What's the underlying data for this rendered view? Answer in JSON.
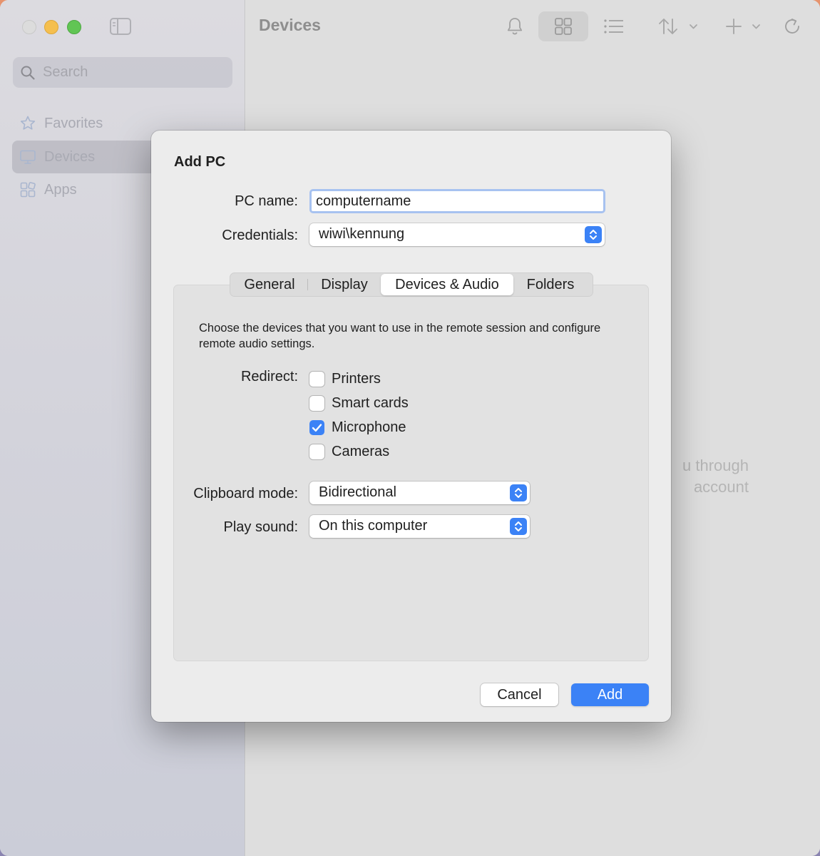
{
  "sidebar": {
    "search_placeholder": "Search",
    "items": [
      {
        "label": "Favorites",
        "icon": "star-icon",
        "selected": false
      },
      {
        "label": "Devices",
        "icon": "monitor-icon",
        "selected": true
      },
      {
        "label": "Apps",
        "icon": "apps-icon",
        "selected": false
      }
    ]
  },
  "toolbar": {
    "title": "Devices",
    "icons": [
      "bell-icon",
      "grid-view-icon",
      "list-view-icon",
      "sort-icon",
      "add-icon",
      "refresh-icon"
    ]
  },
  "main": {
    "empty_line1": "u through",
    "empty_line2": "account"
  },
  "dialog": {
    "title": "Add PC",
    "pc_name_label": "PC name:",
    "pc_name_value": "computername",
    "credentials_label": "Credentials:",
    "credentials_value": "wiwi\\kennung",
    "tabs": [
      {
        "label": "General",
        "selected": false
      },
      {
        "label": "Display",
        "selected": false
      },
      {
        "label": "Devices & Audio",
        "selected": true
      },
      {
        "label": "Folders",
        "selected": false
      }
    ],
    "description": "Choose the devices that you want to use in the remote session and configure remote audio settings.",
    "redirect_label": "Redirect:",
    "redirect_options": [
      {
        "label": "Printers",
        "checked": false
      },
      {
        "label": "Smart cards",
        "checked": false
      },
      {
        "label": "Microphone",
        "checked": true
      },
      {
        "label": "Cameras",
        "checked": false
      }
    ],
    "clipboard_label": "Clipboard mode:",
    "clipboard_value": "Bidirectional",
    "sound_label": "Play sound:",
    "sound_value": "On this computer",
    "cancel_label": "Cancel",
    "add_label": "Add"
  },
  "colors": {
    "accent": "#3b82f6",
    "focus_ring": "#a7c2f0"
  }
}
